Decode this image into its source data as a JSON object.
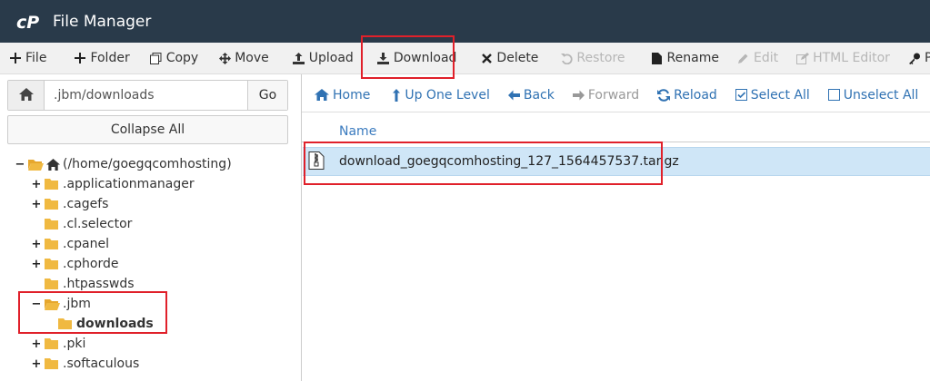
{
  "app": {
    "title": "File Manager",
    "logo": "cpanel-logo"
  },
  "toolbar": {
    "file": "File",
    "folder": "Folder",
    "copy": "Copy",
    "move": "Move",
    "upload": "Upload",
    "download": "Download",
    "delete": "Delete",
    "restore": "Restore",
    "rename": "Rename",
    "edit": "Edit",
    "html_editor": "HTML Editor",
    "permissions": "Pe"
  },
  "pathbar": {
    "value": ".jbm/downloads",
    "go": "Go"
  },
  "collapse_all": "Collapse All",
  "tree": {
    "root": "(/home/goegqcomhosting)",
    "items": [
      ".applicationmanager",
      ".cagefs",
      ".cl.selector",
      ".cpanel",
      ".cphorde",
      ".htpasswds",
      ".jbm",
      "downloads",
      ".pki",
      ".softaculous"
    ]
  },
  "nav": {
    "home": "Home",
    "up": "Up One Level",
    "back": "Back",
    "forward": "Forward",
    "reload": "Reload",
    "select_all": "Select All",
    "unselect_all": "Unselect All"
  },
  "table": {
    "columns": [
      "Name"
    ],
    "rows": [
      {
        "name": "download_goegqcomhosting_127_1564457537.tar.gz",
        "icon": "archive-file-icon"
      }
    ]
  },
  "colors": {
    "topbar": "#293a4a",
    "link": "#3072b3",
    "folder": "#f0b941",
    "highlight": "#e0202a",
    "selected_row": "#cfe6f7"
  }
}
